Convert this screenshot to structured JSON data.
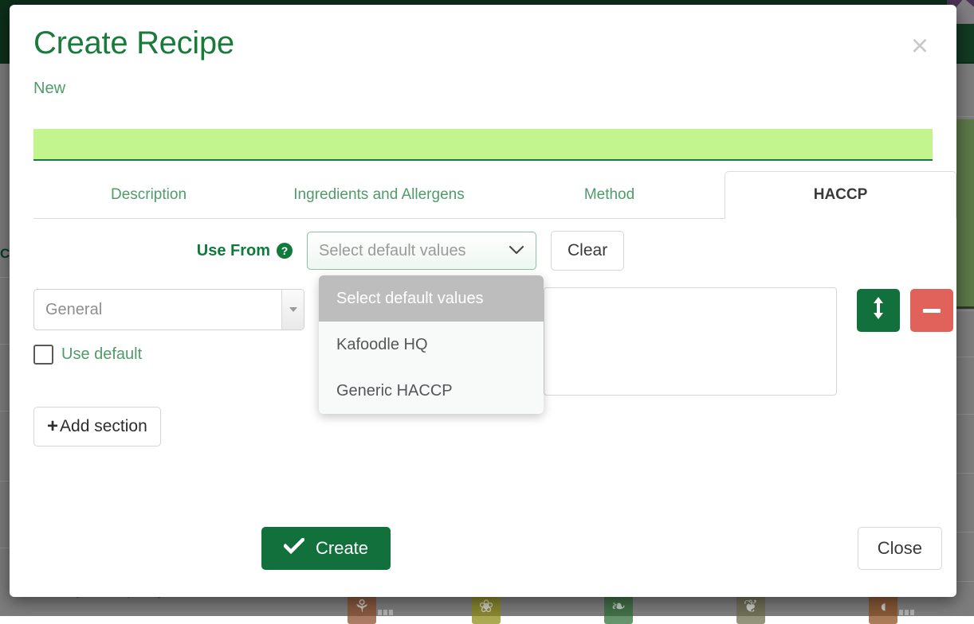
{
  "modal": {
    "title": "Create Recipe",
    "subtitle": "New",
    "close_icon": "close-icon",
    "close_glyph": "×"
  },
  "tabs": [
    {
      "label": "Description",
      "active": false
    },
    {
      "label": "Ingredients and Allergens",
      "active": false
    },
    {
      "label": "Method",
      "active": false
    },
    {
      "label": "HACCP",
      "active": true
    }
  ],
  "use_from": {
    "label": "Use From",
    "help_icon": "help-circle-icon",
    "help_glyph": "?",
    "select": {
      "value": "Select default values",
      "placeholder": "Select default values",
      "chevron_icon": "chevron-down-icon",
      "chevron_glyph": "⌄"
    },
    "clear_label": "Clear"
  },
  "dropdown": {
    "options": [
      {
        "label": "Select default values",
        "highlighted": true
      },
      {
        "label": "Kafoodle HQ",
        "highlighted": false
      },
      {
        "label": "Generic HACCP",
        "highlighted": false
      }
    ]
  },
  "section": {
    "name_select_value": "General",
    "name_select_caret_icon": "caret-down-icon",
    "use_default_label": "Use default",
    "use_default_checked": false,
    "note_value": "",
    "move_button": {
      "icon": "arrows-vertical-icon",
      "glyph": "↕"
    },
    "remove_button": {
      "icon": "minus-icon",
      "glyph": "−"
    }
  },
  "add_section": {
    "label": "Add section",
    "icon": "plus-icon",
    "glyph": "+"
  },
  "footer": {
    "create_label": "Create",
    "create_icon": "check-icon",
    "create_glyph": "✔",
    "close_label": "Close"
  },
  "background": {
    "partial_letter": "C",
    "recipe_text": "Freshly baked pastry filled with",
    "allergens": [
      {
        "name": "allergen-icon-gluten",
        "color": "#8a4a28",
        "glyph": "⚘"
      },
      {
        "name": "allergen-icon-mustard",
        "color": "#8d8a10",
        "glyph": "❀"
      },
      {
        "name": "allergen-icon-celery",
        "color": "#2c6b34",
        "glyph": "❧"
      },
      {
        "name": "allergen-icon-nuts",
        "color": "#6b6b4a",
        "glyph": "❦"
      },
      {
        "name": "allergen-icon-eggs",
        "color": "#8a4a1c",
        "glyph": "◖"
      }
    ]
  },
  "colors": {
    "brand_green": "#12703c",
    "title_green": "#1a7a3c",
    "link_green": "#4f9b6a",
    "banner_green": "#c3f58f",
    "danger_red": "#e0625b",
    "highlight_gray": "#bdbdbd"
  }
}
